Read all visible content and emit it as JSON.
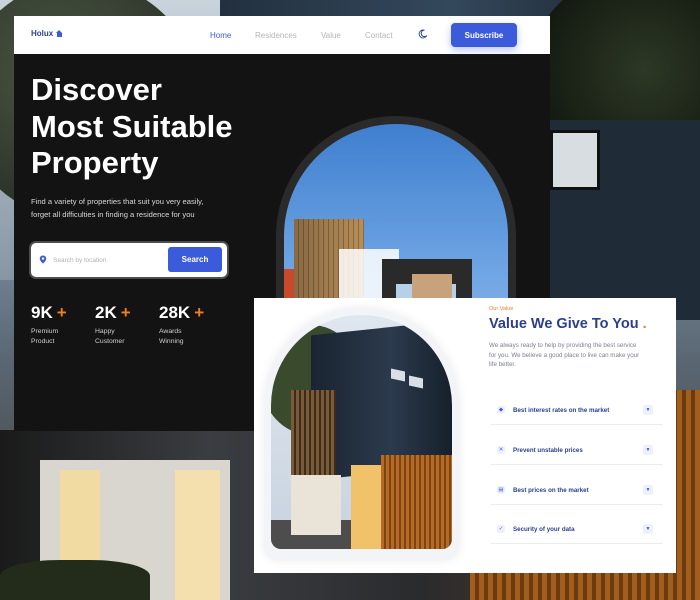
{
  "nav": {
    "logo": "Holux",
    "links": [
      "Home",
      "Residences",
      "Value",
      "Contact"
    ],
    "subscribe_label": "Subscribe"
  },
  "hero": {
    "title_lines": [
      "Discover",
      "Most Suitable",
      "Property"
    ],
    "description_lines": [
      "Find a variety of properties that suit you very easily,",
      "forget all difficulties in finding a residence for you"
    ],
    "search_placeholder": "Search by location",
    "search_button": "Search",
    "stats": [
      {
        "number": "9K",
        "plus": "+",
        "label_lines": [
          "Premium",
          "Product"
        ]
      },
      {
        "number": "2K",
        "plus": "+",
        "label_lines": [
          "Happy",
          "Customer"
        ]
      },
      {
        "number": "28K",
        "plus": "+",
        "label_lines": [
          "Awards",
          "Winning"
        ]
      }
    ]
  },
  "value": {
    "eyebrow": "Our Value",
    "title": "Value We Give To You",
    "title_dot": ".",
    "description_lines": [
      "We always ready to help by providing the best service",
      "for you. We believe a good place to live can make your",
      "life better."
    ],
    "items": [
      "Best interest rates on the market",
      "Prevent unstable prices",
      "Best prices on the market",
      "Security of your data"
    ]
  },
  "colors": {
    "accent": "#3b5bdb",
    "highlight": "#f47c20",
    "heading": "#2c3f8f"
  }
}
